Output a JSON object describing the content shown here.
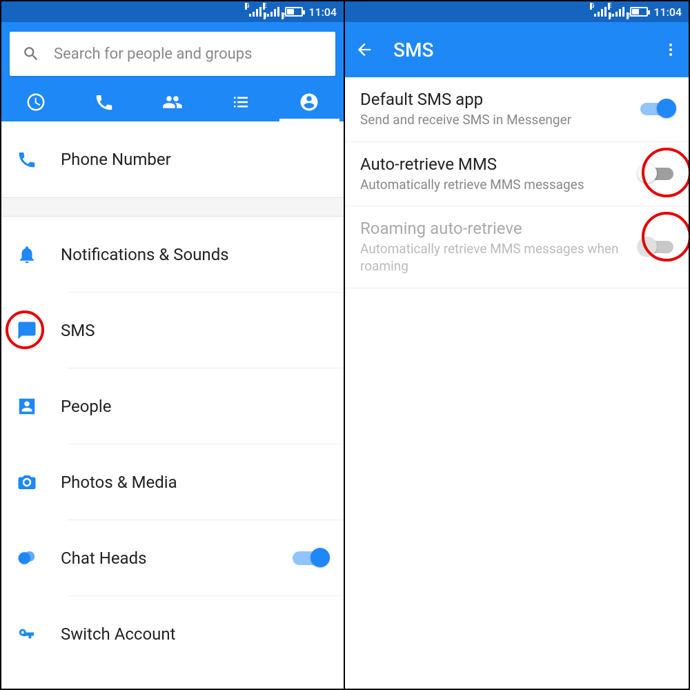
{
  "status_bar": {
    "time": "11:04"
  },
  "left": {
    "search_placeholder": "Search for people and groups",
    "items": [
      {
        "id": "phone-number",
        "label": "Phone Number"
      },
      {
        "id": "notifications",
        "label": "Notifications & Sounds"
      },
      {
        "id": "sms",
        "label": "SMS",
        "highlighted": true
      },
      {
        "id": "people",
        "label": "People"
      },
      {
        "id": "photos-media",
        "label": "Photos & Media"
      },
      {
        "id": "chat-heads",
        "label": "Chat Heads",
        "toggle": "on"
      },
      {
        "id": "switch-account",
        "label": "Switch Account"
      }
    ]
  },
  "right": {
    "title": "SMS",
    "settings": [
      {
        "id": "default-sms",
        "title": "Default SMS app",
        "subtitle": "Send and receive SMS in Messenger",
        "toggle": "on"
      },
      {
        "id": "auto-retrieve",
        "title": "Auto-retrieve MMS",
        "subtitle": "Automatically retrieve MMS messages",
        "toggle": "off",
        "highlighted": true
      },
      {
        "id": "roaming-auto",
        "title": "Roaming auto-retrieve",
        "subtitle": "Automatically retrieve MMS messages when roaming",
        "toggle": "disabled",
        "highlighted": true,
        "disabled": true
      }
    ]
  }
}
